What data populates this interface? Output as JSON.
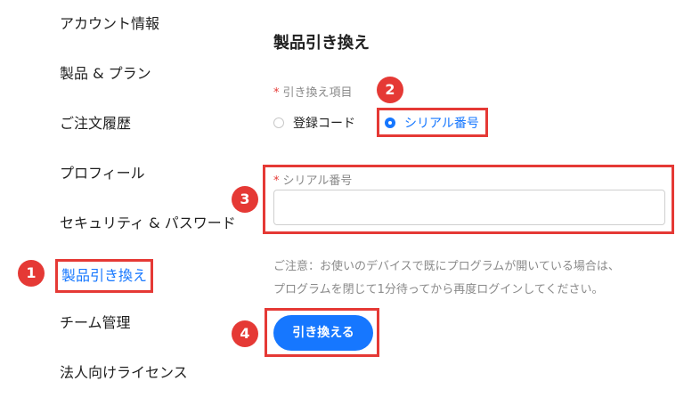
{
  "sidebar": {
    "items": [
      {
        "label": "アカウント情報"
      },
      {
        "label": "製品 & プラン"
      },
      {
        "label": "ご注文履歴"
      },
      {
        "label": "プロフィール"
      },
      {
        "label": "セキュリティ & パスワード"
      },
      {
        "label": "製品引き換え"
      },
      {
        "label": "チーム管理"
      },
      {
        "label": "法人向けライセンス"
      }
    ]
  },
  "main": {
    "title": "製品引き換え",
    "redeem_item_label": "引き換え項目",
    "options": [
      {
        "label": "登録コード",
        "selected": false
      },
      {
        "label": "シリアル番号",
        "selected": true
      }
    ],
    "serial_label": "シリアル番号",
    "serial_value": "",
    "required_mark": "*",
    "note_lines": [
      "ご注意：お使いのデバイスで既にプログラムが開いている場合は、",
      "プログラムを閉じて1分待ってから再度ログインしてください。"
    ],
    "redeem_button": "引き換える"
  },
  "callouts": [
    "1",
    "2",
    "3",
    "4"
  ],
  "colors": {
    "accent": "#1677ff",
    "callout": "#e53935"
  }
}
